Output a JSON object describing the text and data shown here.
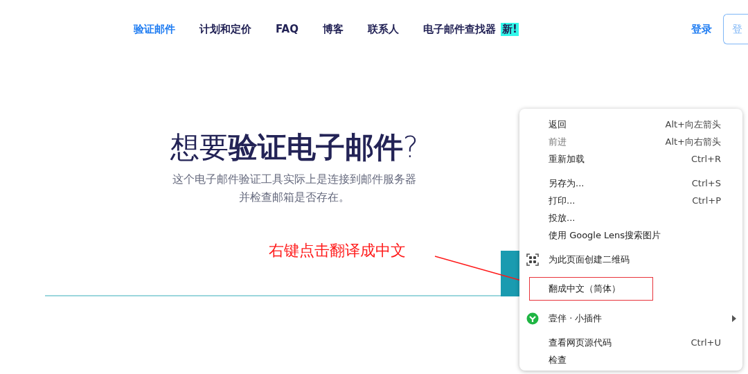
{
  "nav": {
    "items": [
      {
        "label": "验证邮件",
        "selected": true
      },
      {
        "label": "计划和定价",
        "selected": false
      },
      {
        "label": "FAQ",
        "selected": false
      },
      {
        "label": "博客",
        "selected": false
      },
      {
        "label": "联系人",
        "selected": false
      },
      {
        "label": "电子邮件查找器",
        "selected": false,
        "badge": "新!"
      }
    ],
    "login": "登录",
    "signup": "登"
  },
  "hero": {
    "title_light": "想要",
    "title_bold": "验证电子邮件",
    "title_end": "?",
    "subtitle_lines": [
      "这个电子邮件验证工具实际上是连接到邮件服务器",
      "并检查邮箱是否存在。"
    ]
  },
  "annotation": {
    "text": "右键点击翻译成中文"
  },
  "context_menu": {
    "groups": [
      {
        "items": [
          {
            "kind": "plain",
            "label": "返回",
            "shortcut": "Alt+向左箭头",
            "disabled": false
          },
          {
            "kind": "plain",
            "label": "前进",
            "shortcut": "Alt+向右箭头",
            "disabled": true
          },
          {
            "kind": "plain",
            "label": "重新加载",
            "shortcut": "Ctrl+R",
            "disabled": false
          }
        ]
      },
      {
        "items": [
          {
            "kind": "plain",
            "label": "另存为...",
            "shortcut": "Ctrl+S",
            "disabled": false
          },
          {
            "kind": "plain",
            "label": "打印...",
            "shortcut": "Ctrl+P",
            "disabled": false
          },
          {
            "kind": "plain",
            "label": "投放...",
            "disabled": false
          },
          {
            "kind": "plain",
            "label": "使用 Google Lens搜索图片",
            "disabled": false
          }
        ]
      },
      {
        "items": [
          {
            "kind": "qr",
            "label": "为此页面创建二维码",
            "disabled": false
          }
        ]
      },
      {
        "items": [
          {
            "kind": "plain",
            "label": "翻成中文（简体）",
            "disabled": false,
            "highlighted": true
          }
        ]
      },
      {
        "items": [
          {
            "kind": "extension",
            "label": "壹伴 · 小插件",
            "disabled": false
          }
        ]
      },
      {
        "items": [
          {
            "kind": "plain",
            "label": "查看网页源代码",
            "shortcut": "Ctrl+U",
            "disabled": false
          },
          {
            "kind": "plain",
            "label": "检查",
            "disabled": false
          }
        ]
      }
    ]
  }
}
